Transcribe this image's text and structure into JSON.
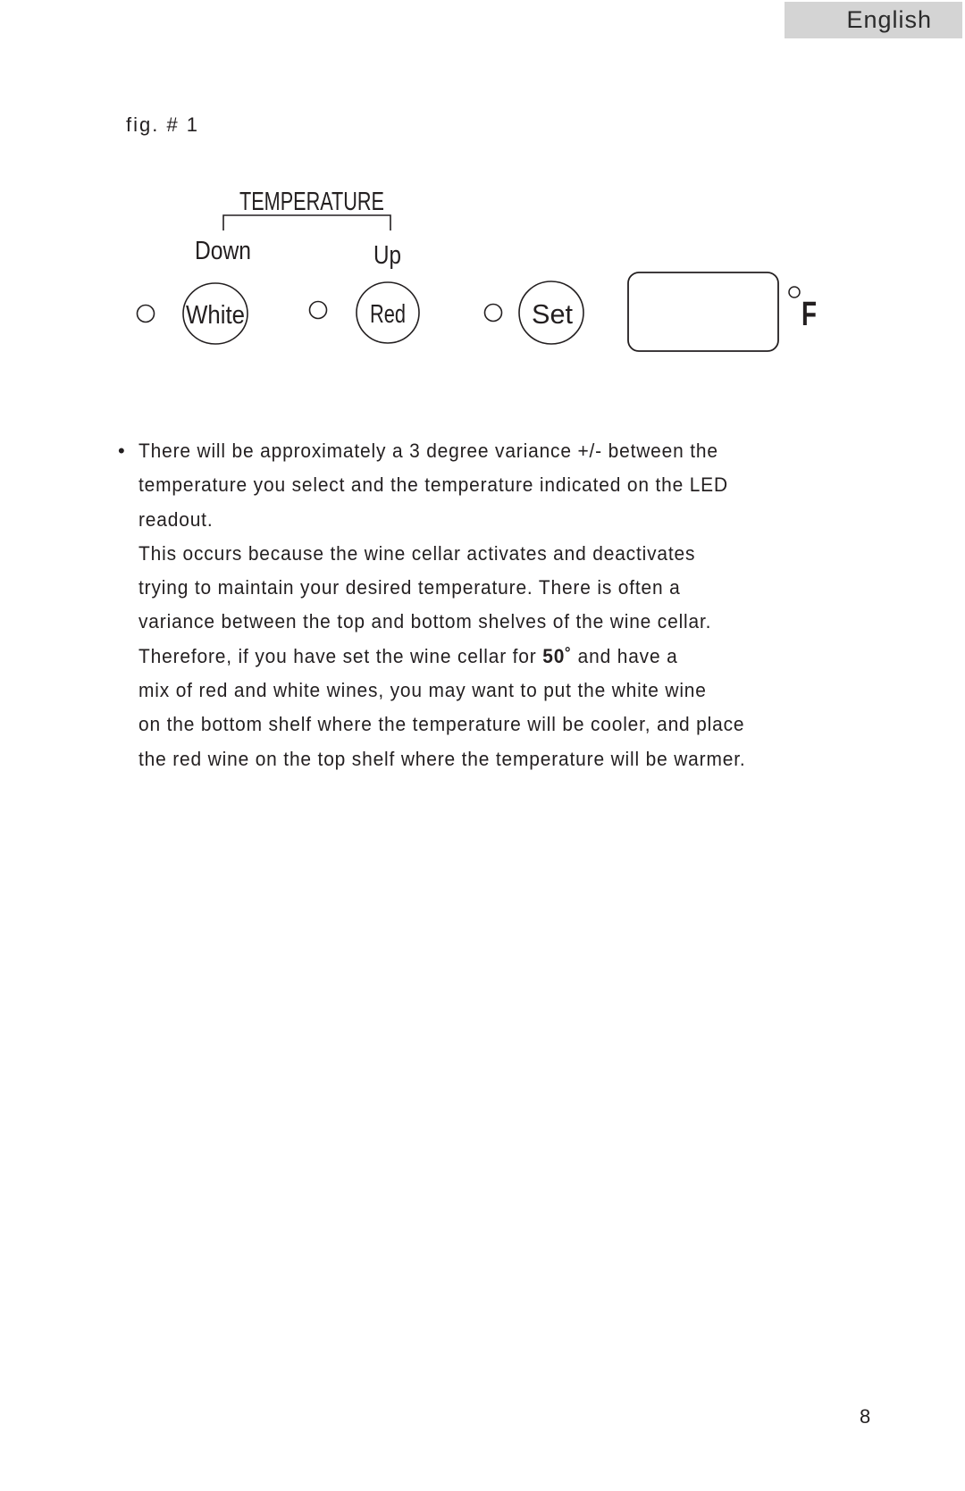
{
  "header": {
    "language_tab": "English"
  },
  "figure": {
    "label": "fig. # 1",
    "panel": {
      "group_label": "TEMPERATURE",
      "down_label": "Down",
      "up_label": "Up",
      "buttons": [
        {
          "label": "White",
          "indicator": "led-indicator"
        },
        {
          "label": "Red",
          "indicator": "led-indicator"
        },
        {
          "label": "Set",
          "indicator": "led-indicator"
        }
      ],
      "display_value": "",
      "unit_degree": "°",
      "unit_letter": "F"
    }
  },
  "content": {
    "bullet": "•",
    "lines": [
      "There will be approximately a 3 degree variance +/- between the",
      "temperature you select and the temperature indicated on the LED",
      "readout.",
      "This occurs because the wine cellar activates and deactivates",
      "trying to maintain your desired temperature. There is often a",
      "variance between the top and bottom shelves of the wine cellar."
    ],
    "line7_before": "Therefore, if you have set the wine cellar for ",
    "line7_bold": "50˚",
    "line7_after": " and have a",
    "lines_after": [
      "mix of red and white wines, you may want to put the white wine",
      "on the bottom shelf where the temperature will be cooler, and place",
      "the red wine on the top shelf where the temperature will be warmer."
    ]
  },
  "footer": {
    "page_number": "8"
  }
}
